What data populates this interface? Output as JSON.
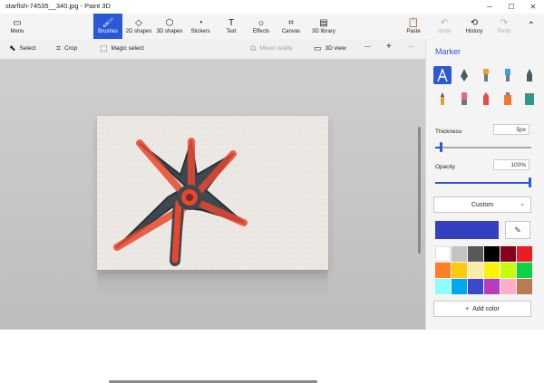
{
  "window": {
    "title": "starfish-74535__340.jpg - Paint 3D",
    "min_icon": "minimize-icon",
    "max_icon": "maximize-icon",
    "close_icon": "close-icon"
  },
  "ribbon": {
    "menu": {
      "label": "Menu",
      "icon": "folder-icon"
    },
    "brushes": {
      "label": "Brushes",
      "icon": "brush-icon"
    },
    "shapes2d": {
      "label": "2D shapes",
      "icon": "2d-shapes-icon"
    },
    "shapes3d": {
      "label": "3D shapes",
      "icon": "3d-cube-icon"
    },
    "stickers": {
      "label": "Stickers",
      "icon": "sticker-icon"
    },
    "text": {
      "label": "Text",
      "icon": "text-icon"
    },
    "effects": {
      "label": "Effects",
      "icon": "sun-icon"
    },
    "canvas": {
      "label": "Canvas",
      "icon": "canvas-icon"
    },
    "library3d": {
      "label": "3D library",
      "icon": "library-icon"
    },
    "paste": {
      "label": "Paste",
      "icon": "paste-icon"
    },
    "undo": {
      "label": "Undo",
      "icon": "undo-icon"
    },
    "history": {
      "label": "History",
      "icon": "history-icon"
    },
    "redo": {
      "label": "Redo",
      "icon": "redo-icon"
    },
    "collapse_icon": "chevron-up-icon"
  },
  "toolbar": {
    "select": "Select",
    "crop": "Crop",
    "magic_select": "Magic select",
    "mixed_reality": "Mixed reality",
    "view3d": "3D view",
    "zoom_out": "—",
    "zoom_in": "+",
    "more": "···"
  },
  "panel": {
    "title": "Marker",
    "thickness_label": "Thickness",
    "thickness_value": "5px",
    "thickness_level": 0.05,
    "opacity_label": "Opacity",
    "opacity_value": "100%",
    "opacity_level": 1.0,
    "finish": "Custom",
    "current_color": "#3440c0",
    "add_color": "Add color",
    "swatches": [
      "#ffffff",
      "#c3c3c3",
      "#585858",
      "#000000",
      "#88001b",
      "#ec1c24",
      "#ff7f27",
      "#ffc90e",
      "#fdeca6",
      "#fff200",
      "#c4ff0e",
      "#0ed145",
      "#8cfffb",
      "#00a8f3",
      "#3f48cc",
      "#b83dba",
      "#ffaec8",
      "#b97a56"
    ]
  },
  "accent": "#2b58d6"
}
